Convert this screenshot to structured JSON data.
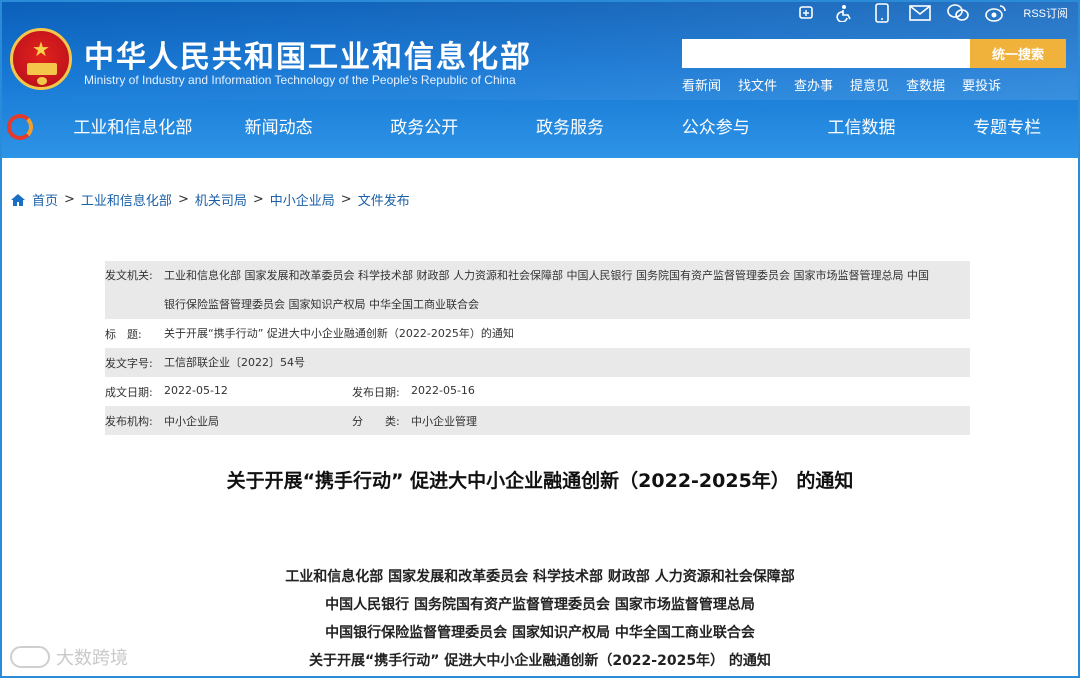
{
  "header": {
    "title": "中华人民共和国工业和信息化部",
    "subtitle": "Ministry of Industry and Information Technology of the People's Republic of China",
    "rss_label": "RSS订阅",
    "search": {
      "placeholder": "",
      "button": "统一搜索"
    },
    "quick_links": [
      "看新闻",
      "找文件",
      "查办事",
      "提意见",
      "查数据",
      "要投诉"
    ]
  },
  "nav": {
    "items": [
      "工业和信息化部",
      "新闻动态",
      "政务公开",
      "政务服务",
      "公众参与",
      "工信数据",
      "专题专栏"
    ]
  },
  "breadcrumb": [
    "首页",
    "工业和信息化部",
    "机关司局",
    "中小企业局",
    "文件发布"
  ],
  "meta": {
    "issuer_label": "发文机关:",
    "issuer_line1": "工业和信息化部 国家发展和改革委员会 科学技术部 财政部 人力资源和社会保障部 中国人民银行 国务院国有资产监督管理委员会 国家市场监督管理总局 中国",
    "issuer_line2": "银行保险监督管理委员会 国家知识产权局 中华全国工商业联合会",
    "title_label": "标　题:",
    "title_value": "关于开展“携手行动” 促进大中小企业融通创新（2022-2025年）的通知",
    "docno_label": "发文字号:",
    "docno_value": "工信部联企业〔2022〕54号",
    "written_label": "成文日期:",
    "written_value": "2022-05-12",
    "published_label": "发布日期:",
    "published_value": "2022-05-16",
    "org_label": "发布机构:",
    "org_value": "中小企业局",
    "category_label": "分　　类:",
    "category_value": "中小企业管理"
  },
  "document": {
    "title": "关于开展“携手行动” 促进大中小企业融通创新（2022-2025年） 的通知",
    "issuers": [
      "工业和信息化部 国家发展和改革委员会 科学技术部 财政部 人力资源和社会保障部",
      "中国人民银行 国务院国有资产监督管理委员会 国家市场监督管理总局",
      "中国银行保险监督管理委员会 国家知识产权局 中华全国工商业联合会",
      "关于开展“携手行动” 促进大中小企业融通创新（2022-2025年） 的通知"
    ]
  },
  "watermark": "大数跨境",
  "colors": {
    "header_blue": "#1677d4",
    "search_button": "#f0b23a",
    "link": "#1a5fa8"
  }
}
